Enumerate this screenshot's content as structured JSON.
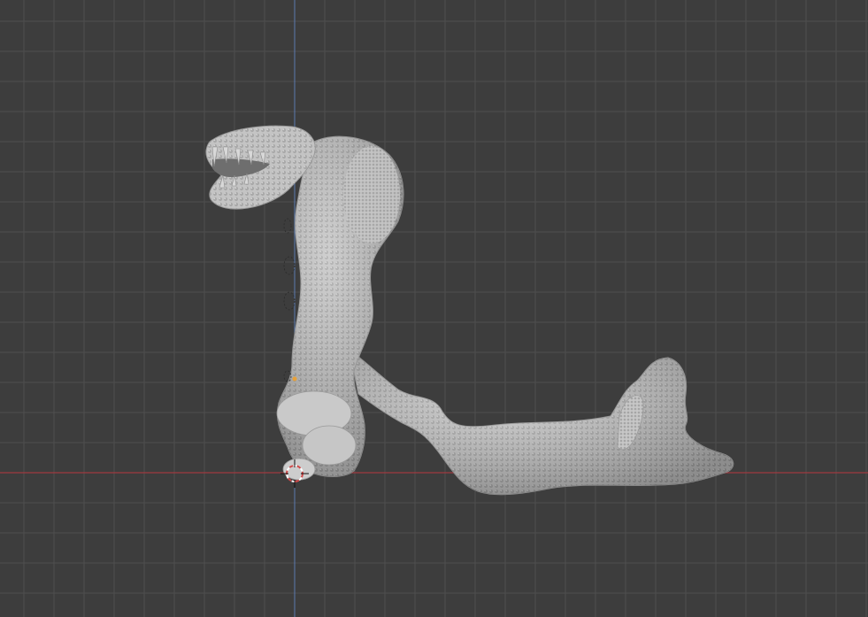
{
  "viewport": {
    "background_color": "#3d3d3d",
    "grid_minor_color": "#454545",
    "grid_major_color": "#4f4f4f",
    "x_axis_color": "#a03a3f",
    "y_axis_color": "#5c7bb0",
    "origin_cursor_color": "#c8b6b6",
    "mesh_color": "#bdbdbd",
    "mesh_shadow_color": "#8f8f8f",
    "selection_dot_color": "#e8a13a",
    "icons": [
      "3d-cursor-icon",
      "object-origin-icon"
    ]
  }
}
